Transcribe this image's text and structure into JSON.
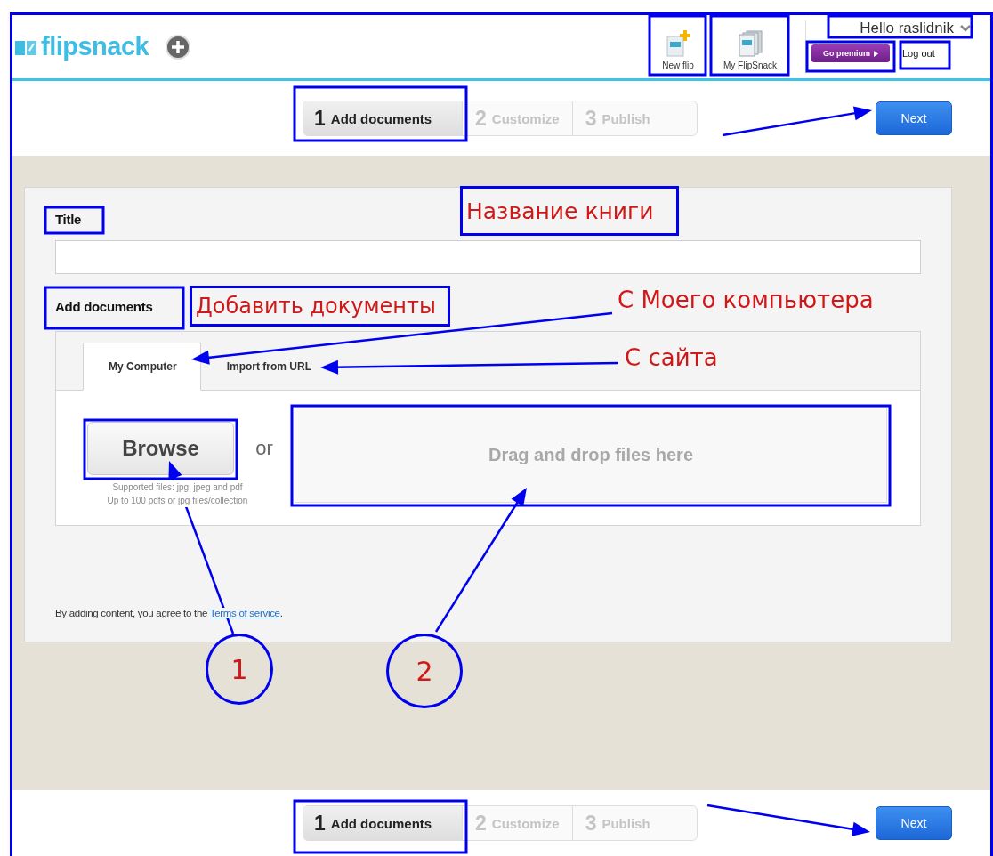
{
  "header": {
    "logo": "flipsnack",
    "nav": [
      {
        "label": "New flip",
        "kind": "new"
      },
      {
        "label": "My FlipSnack",
        "kind": "library"
      }
    ],
    "greeting": "Hello raslidnik",
    "premium": "Go premium",
    "logout": "Log out"
  },
  "steps_top": [
    {
      "number": "1",
      "label": "Add documents",
      "selected": true
    },
    {
      "number": "2",
      "label": "Customize",
      "selected": false
    },
    {
      "number": "3",
      "label": "Publish",
      "selected": false
    }
  ],
  "next_top": "Next",
  "form": {
    "title_label": "Title",
    "add_label": "Add documents",
    "tabs": [
      {
        "label": "My Computer",
        "selected": true
      },
      {
        "label": "Import from URL",
        "selected": false
      }
    ],
    "browse": "Browse",
    "or": "or",
    "supported": [
      "Supported files: jpg, jpeg and pdf",
      "Up to 100 pdfs or jpg files/collection"
    ],
    "dropzone": "Drag and drop files here",
    "terms": "By adding content, you agree to the",
    "terms_link": "Terms of service",
    "terms_end": "."
  },
  "steps_bottom": [
    {
      "number": "1",
      "label": "Add documents",
      "selected": true
    },
    {
      "number": "2",
      "label": "Customize",
      "selected": false
    },
    {
      "number": "3",
      "label": "Publish",
      "selected": false
    }
  ],
  "next_bottom": "Next",
  "annotations": {
    "labels": [
      {
        "text": "Название книги",
        "kind": "boxed"
      },
      {
        "text": "Добавить документы",
        "kind": "boxed"
      },
      {
        "text": "С Моего компьютера",
        "kind": "plain"
      },
      {
        "text": "С сайта",
        "kind": "plain"
      }
    ],
    "markers": [
      "1",
      "2"
    ]
  }
}
